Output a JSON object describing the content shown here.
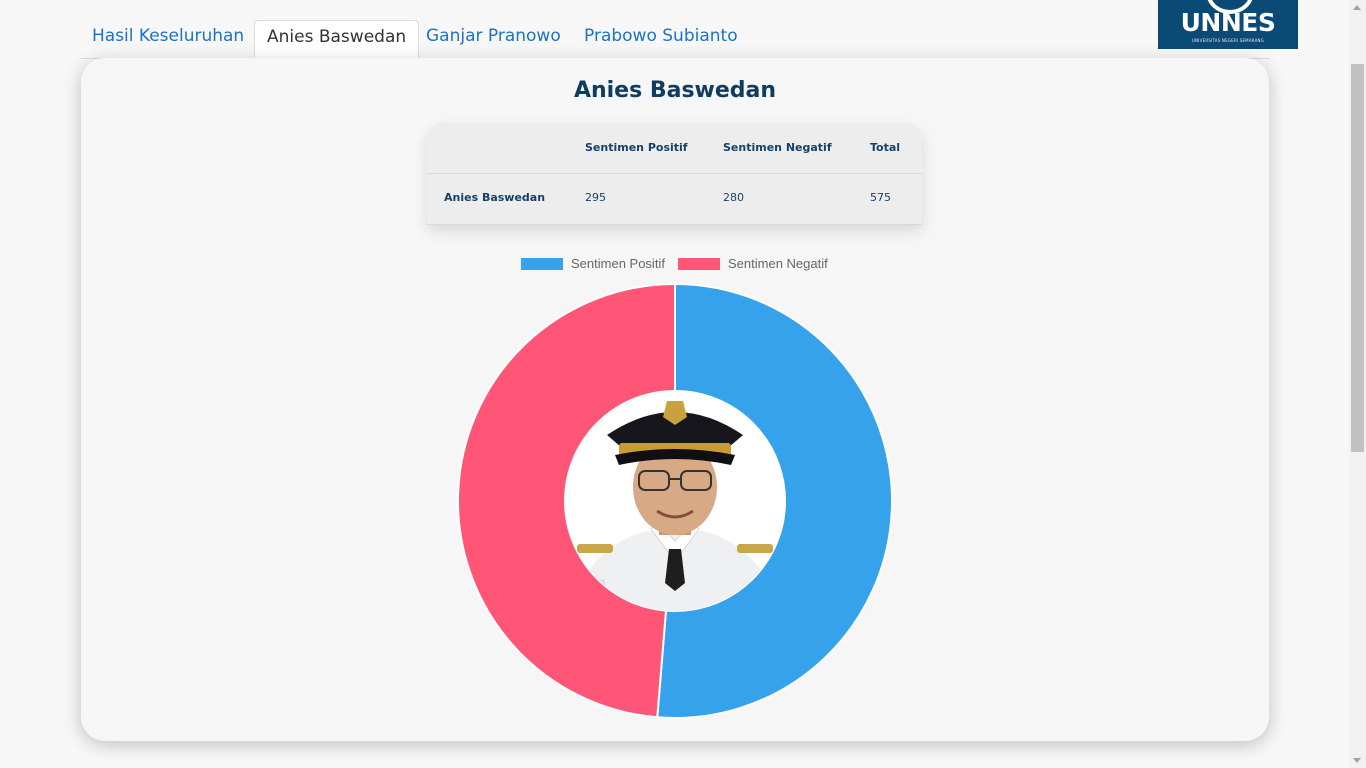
{
  "tabs": [
    {
      "label": "Hasil Keseluruhan",
      "active": false
    },
    {
      "label": "Anies Baswedan",
      "active": true
    },
    {
      "label": "Ganjar Pranowo",
      "active": false
    },
    {
      "label": "Prabowo Subianto",
      "active": false
    }
  ],
  "logo": {
    "text": "UNNES",
    "subtitle": "UNIVERSITAS NEGERI SEMARANG",
    "bg_color": "#0b4a74"
  },
  "card": {
    "title": "Anies Baswedan"
  },
  "table": {
    "headers": [
      "",
      "Sentimen Positif",
      "Sentimen Negatif",
      "Total"
    ],
    "rows": [
      [
        "Anies Baswedan",
        "295",
        "280",
        "575"
      ]
    ]
  },
  "chart_data": {
    "type": "pie",
    "variant": "doughnut",
    "categories": [
      "Sentimen Positif",
      "Sentimen Negatif"
    ],
    "values": [
      295,
      280
    ],
    "colors": [
      "#36a2eb",
      "#ff5678"
    ],
    "legend_position": "top",
    "center_image": "portrait-photo"
  }
}
